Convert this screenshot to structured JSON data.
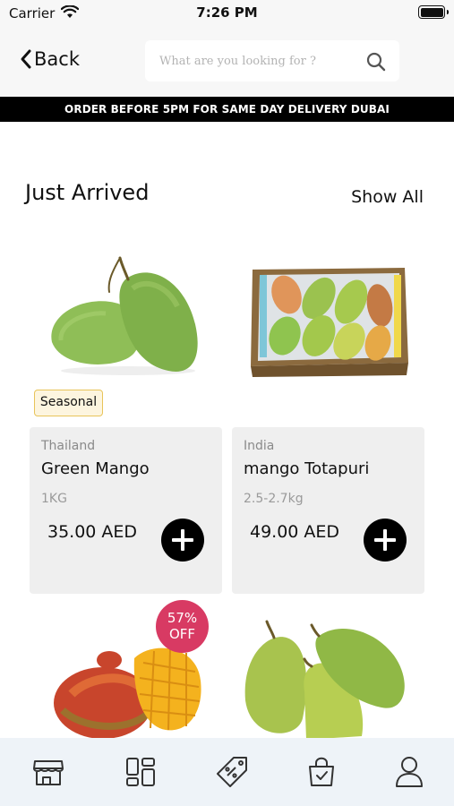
{
  "status_bar": {
    "carrier": "Carrier",
    "time": "7:26 PM"
  },
  "header": {
    "back_label": "Back",
    "search_placeholder": "What are you looking for ?"
  },
  "banner": {
    "text": "ORDER BEFORE 5PM FOR SAME DAY DELIVERY DUBAI"
  },
  "section": {
    "title": "Just Arrived",
    "show_all": "Show All"
  },
  "products": [
    {
      "origin": "Thailand",
      "name": "Green Mango",
      "weight": "1KG",
      "price": "35.00 AED",
      "badge": "Seasonal"
    },
    {
      "origin": "India",
      "name": "mango Totapuri",
      "weight": "2.5-2.7kg",
      "price": "49.00 AED"
    }
  ],
  "discount": {
    "value": "57%",
    "label": "OFF"
  },
  "tab_bar": {
    "items": [
      {
        "icon": "store-icon"
      },
      {
        "icon": "categories-icon"
      },
      {
        "icon": "offers-tag-icon"
      },
      {
        "icon": "shopping-bag-icon"
      },
      {
        "icon": "profile-icon"
      }
    ]
  },
  "colors": {
    "banner_bg": "#000000",
    "discount_bg": "#d83a63",
    "seasonal_border": "#e8c45a",
    "tab_bar_bg": "#eef3f8"
  }
}
